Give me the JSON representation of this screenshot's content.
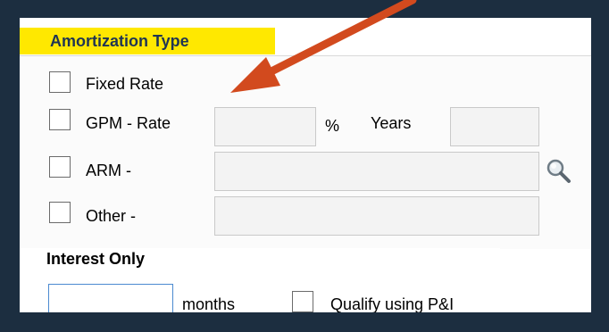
{
  "amortization": {
    "title": "Amortization Type",
    "options": {
      "fixed": {
        "label": "Fixed Rate"
      },
      "gpm": {
        "label": "GPM - Rate",
        "rate_value": "",
        "percent_label": "%",
        "years_label": "Years",
        "years_value": ""
      },
      "arm": {
        "label": "ARM -",
        "value": ""
      },
      "other": {
        "label": "Other -",
        "value": ""
      }
    }
  },
  "interest_only": {
    "title": "Interest Only",
    "months_value": "",
    "months_label": "months",
    "qualify_label": "Qualify using P&I"
  },
  "icons": {
    "lookup": "search-icon",
    "annotation": "arrow-annotation"
  },
  "colors": {
    "frame": "#1c2e40",
    "title_highlight": "#ffe800",
    "arrow": "#d24a1e",
    "input_focus": "#4b8ad0"
  }
}
